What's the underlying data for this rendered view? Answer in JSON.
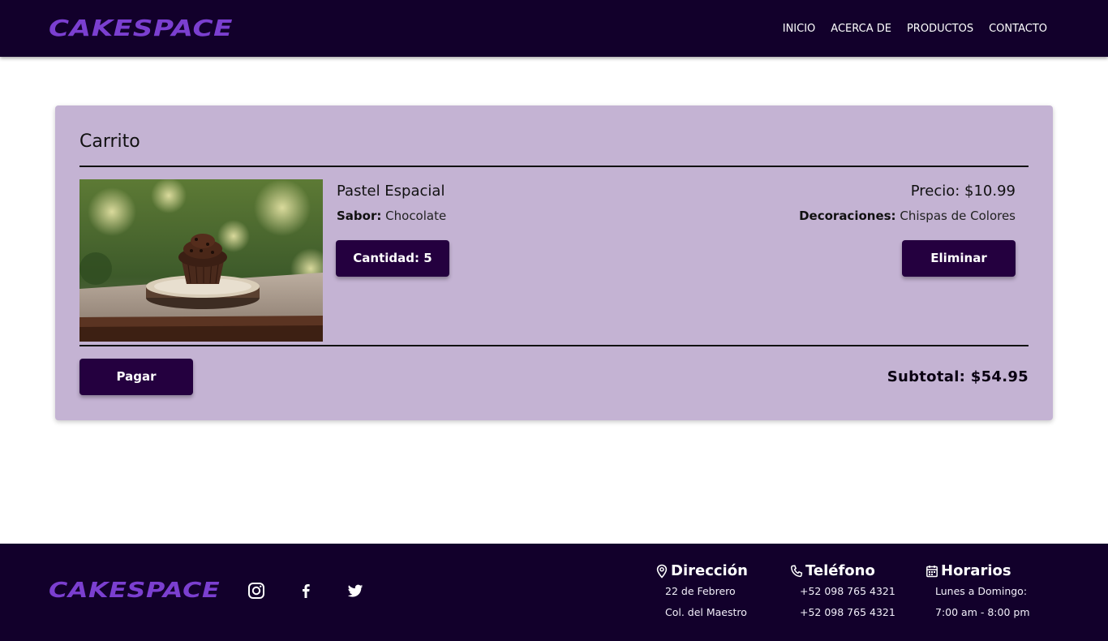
{
  "header": {
    "logo": "CAKESPACE",
    "nav": [
      "INICIO",
      "ACERCA DE",
      "PRODUCTOS",
      "CONTACTO"
    ]
  },
  "cart": {
    "title": "Carrito",
    "item": {
      "name": "Pastel Espacial",
      "flavor_label": "Sabor:",
      "flavor_value": "Chocolate",
      "price": "Precio: $10.99",
      "decorations_label": "Decoraciones:",
      "decorations_value": "Chispas de Colores",
      "quantity_button": "Cantidad: 5",
      "remove_button": "Eliminar",
      "image_icon": "cupcake-photo"
    },
    "pay_button": "Pagar",
    "subtotal": "Subtotal: $54.95"
  },
  "footer": {
    "logo": "CAKESPACE",
    "social_icons": [
      "instagram-icon",
      "facebook-icon",
      "twitter-icon"
    ],
    "address": {
      "title": "Dirección",
      "icon": "location-pin-icon",
      "lines": [
        "22 de Febrero",
        "Col. del Maestro"
      ]
    },
    "phone": {
      "title": "Teléfono",
      "icon": "phone-icon",
      "lines": [
        "+52 098 765 4321",
        "+52 098 765 4321"
      ]
    },
    "hours": {
      "title": "Horarios",
      "icon": "calendar-icon",
      "lines": [
        "Lunes a Domingo:",
        "7:00 am - 8:00 pm"
      ]
    }
  },
  "colors": {
    "dark_purple": "#12002b",
    "button_purple": "#24003f",
    "card_lavender": "#c4b3d3",
    "logo_purple": "#7b3fd0"
  }
}
